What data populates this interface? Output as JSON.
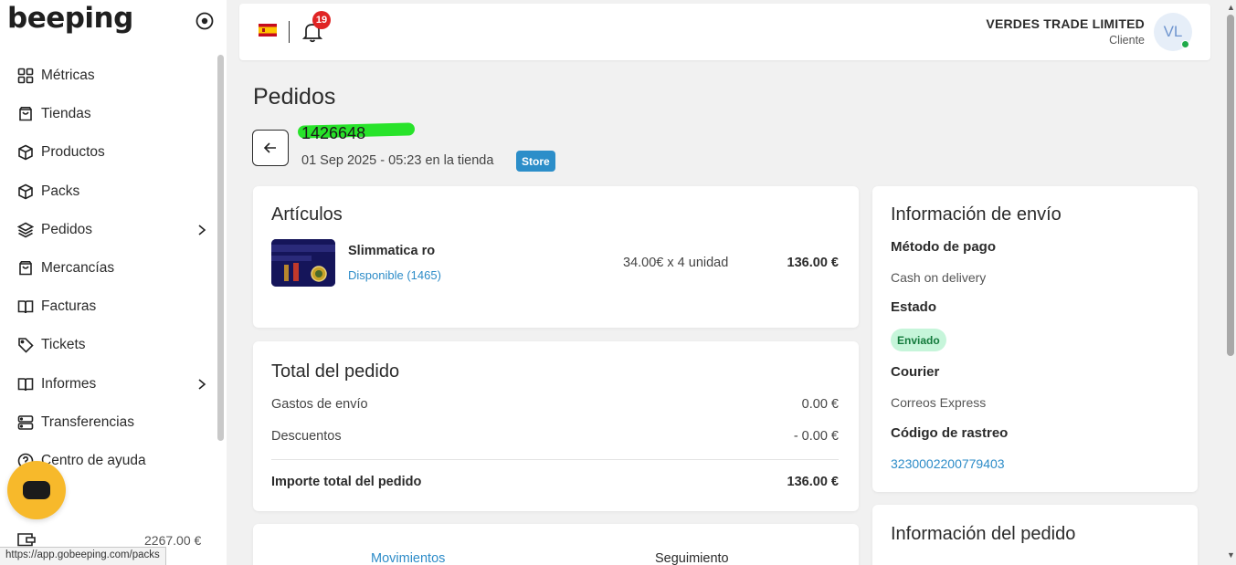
{
  "brand": {
    "logo_text": "beeping"
  },
  "sidebar": {
    "items": [
      {
        "label": "Métricas",
        "icon": "grid-icon"
      },
      {
        "label": "Tiendas",
        "icon": "bag-icon"
      },
      {
        "label": "Productos",
        "icon": "box-icon"
      },
      {
        "label": "Packs",
        "icon": "box-icon"
      },
      {
        "label": "Pedidos",
        "icon": "layers-icon",
        "expandable": true
      },
      {
        "label": "Mercancías",
        "icon": "bag-icon"
      },
      {
        "label": "Facturas",
        "icon": "book-icon"
      },
      {
        "label": "Tickets",
        "icon": "tag-icon"
      },
      {
        "label": "Informes",
        "icon": "book-icon",
        "expandable": true
      },
      {
        "label": "Transferencias",
        "icon": "server-icon"
      },
      {
        "label": "Centro de ayuda",
        "icon": "help-icon"
      }
    ],
    "balance": "2267.00 €",
    "status_url": "https://app.gobeeping.com/packs"
  },
  "topbar": {
    "notifications_count": "19",
    "company_name": "VERDES TRADE LIMITED",
    "role": "Cliente",
    "avatar_initials": "VL"
  },
  "page": {
    "title": "Pedidos",
    "order_id": "1426648",
    "order_meta": "01 Sep 2025 - 05:23 en la tienda",
    "store_badge": "Store"
  },
  "articles": {
    "title": "Artículos",
    "item": {
      "name": "Slimmatica ro",
      "stock": "Disponible (1465)",
      "qty_price": "34.00€ x 4 unidad",
      "total": "136.00 €"
    }
  },
  "totals": {
    "title": "Total del pedido",
    "shipping_label": "Gastos de envío",
    "shipping_value": "0.00 €",
    "discount_label": "Descuentos",
    "discount_value": "- 0.00 €",
    "total_label": "Importe total del pedido",
    "total_value": "136.00 €"
  },
  "tabs": {
    "movements": "Movimientos",
    "tracking": "Seguimiento"
  },
  "shipping": {
    "title": "Información de envío",
    "payment_label": "Método de pago",
    "payment_value": "Cash on delivery",
    "status_label": "Estado",
    "status_value": "Enviado",
    "courier_label": "Courier",
    "courier_value": "Correos Express",
    "tracking_label": "Código de rastreo",
    "tracking_value": "3230002200779403"
  },
  "order_info": {
    "title": "Información del pedido"
  },
  "colors": {
    "accent": "#2c8ec9",
    "chat": "#f7b92b",
    "highlight": "#28e32a",
    "status_bg": "#c6f5da",
    "badge": "#e02424"
  }
}
